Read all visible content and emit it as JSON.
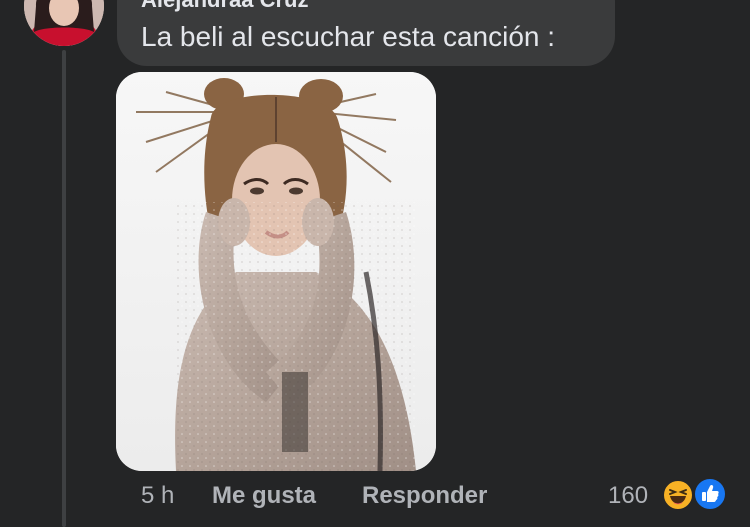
{
  "comment": {
    "author": "Alejandraa Cruz",
    "text": "La beli al escuchar esta canción :",
    "photo": "woman-with-spiky-buns-in-sequin-mesh-top"
  },
  "actions": {
    "time": "5 h",
    "like_label": "Me gusta",
    "reply_label": "Responder"
  },
  "reactions": {
    "count": "160",
    "icons": [
      "haha-reaction-icon",
      "like-reaction-icon"
    ]
  },
  "colors": {
    "background": "#242526",
    "bubble": "#3a3b3c",
    "text": "#e4e6eb",
    "secondary_text": "#b0b3b8",
    "like_blue": "#1877f2",
    "haha_yellow": "#f7b125"
  }
}
